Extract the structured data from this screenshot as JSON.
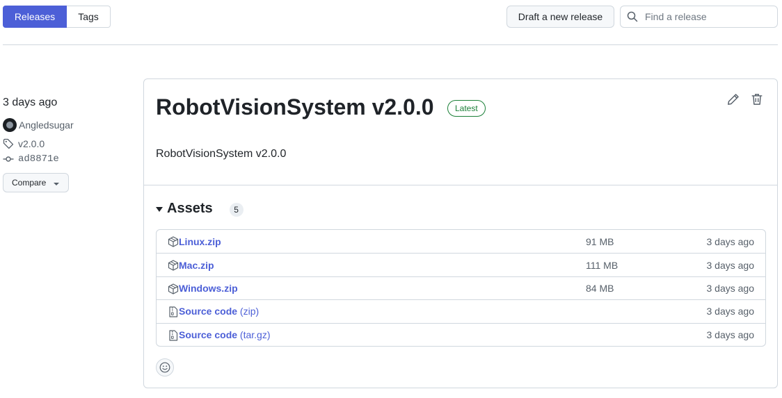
{
  "nav": {
    "tabs": [
      {
        "label": "Releases",
        "active": true
      },
      {
        "label": "Tags",
        "active": false
      }
    ],
    "draft_label": "Draft a new release",
    "search_placeholder": "Find a release"
  },
  "release_meta": {
    "date": "3 days ago",
    "author": "Angledsugar",
    "tag": "v2.0.0",
    "commit": "ad8871e",
    "compare_label": "Compare"
  },
  "release": {
    "title": "RobotVisionSystem v2.0.0",
    "badge": "Latest",
    "body": "RobotVisionSystem v2.0.0",
    "assets_label": "Assets",
    "assets_count": "5",
    "assets": [
      {
        "name": "Linux.zip",
        "suffix": "",
        "size": "91 MB",
        "date": "3 days ago",
        "icon": "package-icon"
      },
      {
        "name": "Mac.zip",
        "suffix": "",
        "size": "111 MB",
        "date": "3 days ago",
        "icon": "package-icon"
      },
      {
        "name": "Windows.zip",
        "suffix": "",
        "size": "84 MB",
        "date": "3 days ago",
        "icon": "package-icon"
      },
      {
        "name": "Source code",
        "suffix": "(zip)",
        "size": "",
        "date": "3 days ago",
        "icon": "file-zip-icon"
      },
      {
        "name": "Source code",
        "suffix": "(tar.gz)",
        "size": "",
        "date": "3 days ago",
        "icon": "file-zip-icon"
      }
    ]
  },
  "colors": {
    "accent": "#4c5fd7",
    "latest_green": "#1a7f37",
    "border": "#d0d7de",
    "muted": "#57606a"
  }
}
